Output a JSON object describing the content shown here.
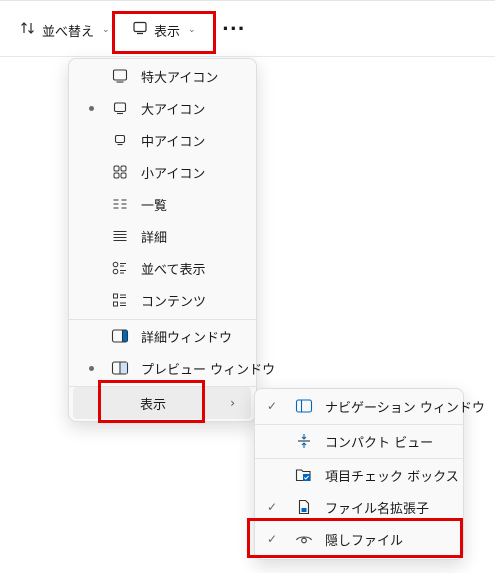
{
  "toolbar": {
    "sort_label": "並べ替え",
    "view_label": "表示",
    "more_label": "..."
  },
  "view_menu": {
    "items": [
      {
        "label": "特大アイコン",
        "icon": "monitor-icon",
        "selected": false
      },
      {
        "label": "大アイコン",
        "icon": "monitor-icon",
        "selected": true
      },
      {
        "label": "中アイコン",
        "icon": "monitor-icon",
        "selected": false
      },
      {
        "label": "小アイコン",
        "icon": "small-icons-grid-icon",
        "selected": false
      },
      {
        "label": "一覧",
        "icon": "list-icon",
        "selected": false
      },
      {
        "label": "詳細",
        "icon": "details-icon",
        "selected": false
      },
      {
        "label": "並べて表示",
        "icon": "tiles-icon",
        "selected": false
      },
      {
        "label": "コンテンツ",
        "icon": "content-icon",
        "selected": false
      }
    ],
    "panes": [
      {
        "label": "詳細ウィンドウ",
        "icon": "details-pane-icon",
        "selected": false
      },
      {
        "label": "プレビュー ウィンドウ",
        "icon": "preview-pane-icon",
        "selected": true
      }
    ],
    "show": {
      "label": "表示",
      "icon": "chevron-right-icon"
    }
  },
  "show_submenu": {
    "items": [
      {
        "label": "ナビゲーション ウィンドウ",
        "icon": "navigation-pane-icon",
        "checked": true
      },
      {
        "label": "コンパクト ビュー",
        "icon": "compact-view-icon",
        "checked": false
      },
      {
        "label": "項目チェック ボックス",
        "icon": "item-checkbox-icon",
        "checked": false
      },
      {
        "label": "ファイル名拡張子",
        "icon": "file-extension-icon",
        "checked": true
      },
      {
        "label": "隠しファイル",
        "icon": "eye-icon",
        "checked": true
      }
    ]
  },
  "colors": {
    "highlight_box": "#e00000",
    "accent": "#0067c0"
  }
}
